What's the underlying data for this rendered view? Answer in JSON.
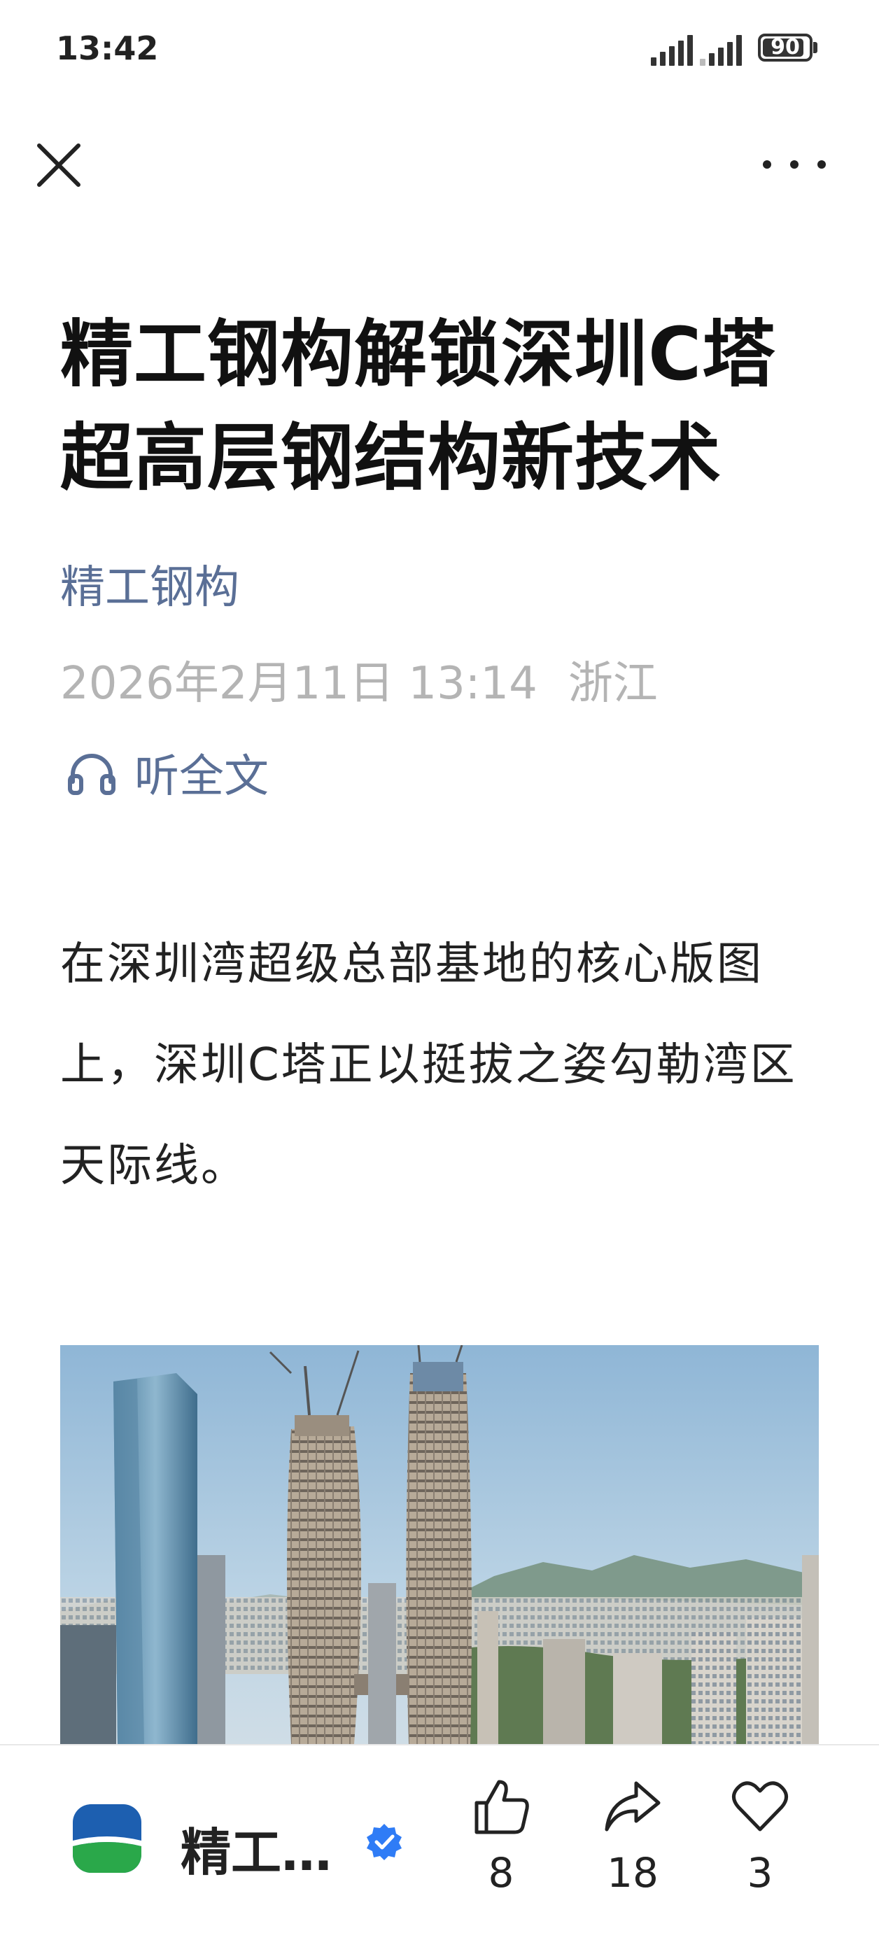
{
  "status_bar": {
    "time": "13:42",
    "battery": "90",
    "battery_level": 0.9
  },
  "article": {
    "title": "精工钢构解锁深圳C塔超高层钢结构新技术",
    "author": "精工钢构",
    "date": "2026年2月11日 13:14",
    "location": "浙江",
    "listen_label": "听全文",
    "body": "在深圳湾超级总部基地的核心版图上，深圳C塔正以挺拔之姿勾勒湾区天际线。"
  },
  "bottom_bar": {
    "account_name": "精工…",
    "likes": "8",
    "shares": "18",
    "favorites": "3"
  },
  "icons": {
    "close": "close-icon",
    "more": "more-icon",
    "headphones": "headphones-icon",
    "verified": "verified-badge-icon",
    "like": "thumbs-up-icon",
    "share": "share-icon",
    "favorite": "heart-icon"
  },
  "colors": {
    "accent": "#5a6f96",
    "meta": "#b4b4b4",
    "verified": "#2f7cf6"
  }
}
